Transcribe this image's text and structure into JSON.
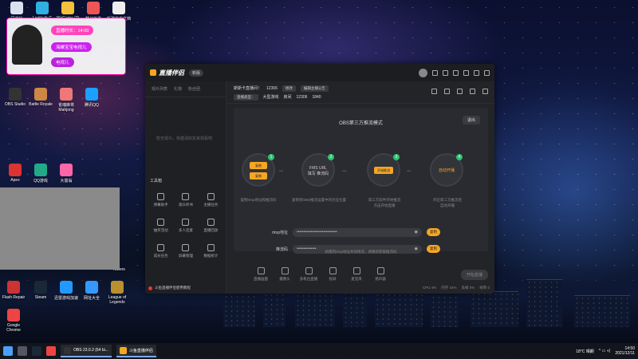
{
  "desktop": {
    "icons_top": [
      {
        "label": "回收站",
        "color": "#d9e3f0"
      },
      {
        "label": "Logitech G",
        "color": "#2fb0e0"
      },
      {
        "label": "WeGame (2)",
        "color": "#f5c13b"
      },
      {
        "label": "梦幻西游",
        "color": "#e55"
      },
      {
        "label": "新建文本文档",
        "color": "#eee"
      }
    ],
    "icons_left": [
      {
        "label": "OBS Studio",
        "color": "#333"
      },
      {
        "label": "Battle Royale",
        "color": "#c84"
      },
      {
        "label": "雀魂麻将 Mahjong",
        "color": "#e77"
      },
      {
        "label": "腾讯QQ",
        "color": "#1aa0ff"
      },
      {
        "label": "Apex",
        "color": "#d33"
      },
      {
        "label": "QQ游戏",
        "color": "#2a8"
      },
      {
        "label": "大富翁",
        "color": "#f6a"
      },
      {
        "label": "Flash Repair",
        "color": "#c33"
      },
      {
        "label": "Steam",
        "color": "#1b2838"
      },
      {
        "label": "迅雷游戏加速",
        "color": "#29f"
      },
      {
        "label": "网址大全",
        "color": "#39f"
      },
      {
        "label": "League of Legends",
        "color": "#b8902e"
      },
      {
        "label": "Google Chrome",
        "color": "#e44"
      }
    ],
    "right_label": "Towers"
  },
  "widget": {
    "chip1": "直播时长：14:00",
    "chip2": "海螺宝宝电视儿",
    "chip3": "电视儿"
  },
  "app": {
    "title": "直播伴侣",
    "version_badge": "新版",
    "left_tabs": [
      "观众列表",
      "礼物",
      "粉丝团"
    ],
    "empty_message": "暂无观众，快邀请好友来观看吧",
    "tools_title": "工具箱",
    "tools": [
      {
        "label": "弹幕助手"
      },
      {
        "label": "观众听书"
      },
      {
        "label": "主播任务"
      },
      {
        "label": "抽奖活动"
      },
      {
        "label": "多人连麦"
      },
      {
        "label": "直播回放"
      },
      {
        "label": "成长任务"
      },
      {
        "label": "屏幕管理"
      },
      {
        "label": "数据统计"
      }
    ],
    "notice": "斗鱼直播伴侣使用教程",
    "info": {
      "room_label": "斯斯卡直播间！",
      "room_id": "12306",
      "room_tag": "修改",
      "announce": "编辑主播公告",
      "category_label": "直播类型：",
      "category": "大型游戏",
      "id_label": "房间",
      "id_value": "12306",
      "fans": "1840"
    },
    "obs": {
      "title": "OBS第三方推流模式",
      "exit": "退出",
      "steps": [
        {
          "num": "1",
          "text": "",
          "btn_top": "复制",
          "btn_bottom": "复制",
          "caption": "复制rtmp地址和推流码"
        },
        {
          "num": "2",
          "text": "FMS URL\n填写 推流码",
          "caption": "复制到OBS推流设置中的对应位置"
        },
        {
          "num": "3",
          "text": "开始推流",
          "caption": "第三方软件开始推流\n点击开始直播"
        },
        {
          "num": "4",
          "text": "自动开播",
          "caption": "开启第三方推流后\n自动开播"
        }
      ],
      "rtmp_label": "rtmp地址",
      "rtmp_value": "•••••••••••••••••••••••••••••",
      "key_label": "推流码",
      "key_value": "••••••••••••••",
      "copy": "复制",
      "hint": "如遇到rtmp地址失效情况，请重新获取推流码"
    },
    "bottom": [
      {
        "label": "直播画面"
      },
      {
        "label": "摄像头"
      },
      {
        "label": "多机位直播"
      },
      {
        "label": "投屏"
      },
      {
        "label": "麦克风"
      },
      {
        "label": "扬声器"
      }
    ],
    "start_live": "开始直播",
    "stats": [
      "CPU 4%",
      "内存 24%",
      "丢帧 0%",
      "帧率 0"
    ]
  },
  "taskbar": {
    "tasks": [
      "OBS 23.0.2 (64 bi...",
      "斗鱼直播伴侣"
    ],
    "weather": "18°C 晴朗",
    "time": "14:50",
    "date": "2021/12/11"
  }
}
